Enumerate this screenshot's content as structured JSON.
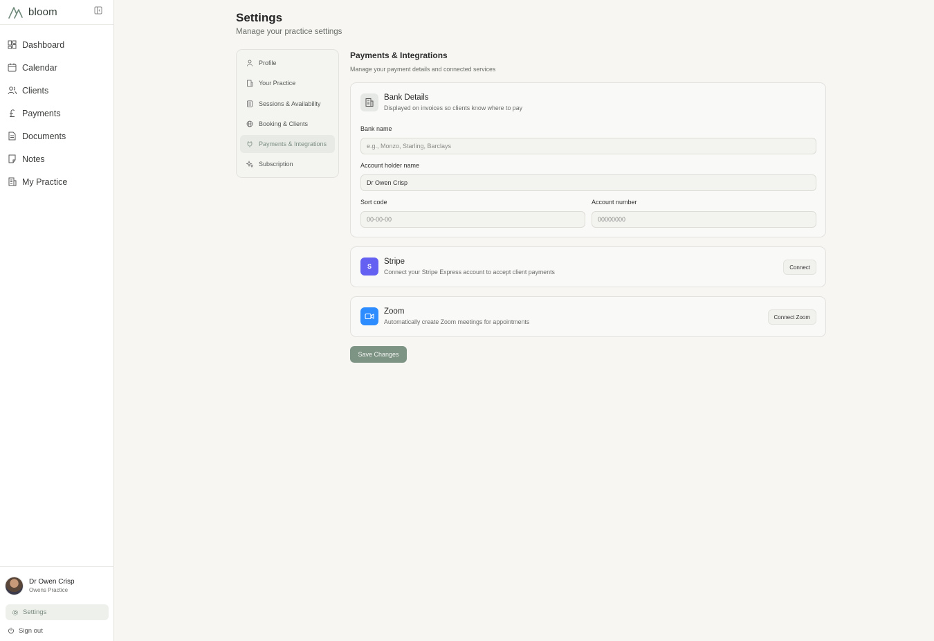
{
  "brand": {
    "name": "bloom"
  },
  "sidebar": {
    "items": [
      {
        "label": "Dashboard",
        "icon": "dashboard-icon"
      },
      {
        "label": "Calendar",
        "icon": "calendar-icon"
      },
      {
        "label": "Clients",
        "icon": "users-icon"
      },
      {
        "label": "Payments",
        "icon": "pound-icon"
      },
      {
        "label": "Documents",
        "icon": "document-icon"
      },
      {
        "label": "Notes",
        "icon": "note-icon"
      },
      {
        "label": "My Practice",
        "icon": "building-icon"
      }
    ],
    "user": {
      "name": "Dr Owen Crisp",
      "practice": "Owens Practice"
    },
    "settings_label": "Settings",
    "signout_label": "Sign out"
  },
  "page": {
    "title": "Settings",
    "subtitle": "Manage your practice settings"
  },
  "settings_nav": {
    "items": [
      {
        "label": "Profile",
        "icon": "user-icon"
      },
      {
        "label": "Your Practice",
        "icon": "building-icon"
      },
      {
        "label": "Sessions & Availability",
        "icon": "calendar-grid-icon"
      },
      {
        "label": "Booking & Clients",
        "icon": "globe-icon"
      },
      {
        "label": "Payments & Integrations",
        "icon": "plug-icon",
        "active": true
      },
      {
        "label": "Subscription",
        "icon": "sparkles-icon"
      }
    ]
  },
  "section": {
    "title": "Payments & Integrations",
    "subtitle": "Manage your payment details and connected services"
  },
  "bank": {
    "title": "Bank Details",
    "desc": "Displayed on invoices so clients know where to pay",
    "bank_name_label": "Bank name",
    "bank_name_placeholder": "e.g., Monzo, Starling, Barclays",
    "bank_name_value": "",
    "holder_label": "Account holder name",
    "holder_value": "Dr Owen Crisp",
    "sort_label": "Sort code",
    "sort_placeholder": "00-00-00",
    "account_label": "Account number",
    "account_placeholder": "00000000"
  },
  "stripe": {
    "icon_letter": "S",
    "title": "Stripe",
    "desc": "Connect your Stripe Express account to accept client payments",
    "button": "Connect"
  },
  "zoom": {
    "title": "Zoom",
    "desc": "Automatically create Zoom meetings for appointments",
    "button": "Connect Zoom"
  },
  "save_label": "Save Changes",
  "colors": {
    "accent": "#7d9384",
    "stripe": "#6360f2",
    "zoom": "#2d8cff",
    "background": "#f7f6f3"
  }
}
